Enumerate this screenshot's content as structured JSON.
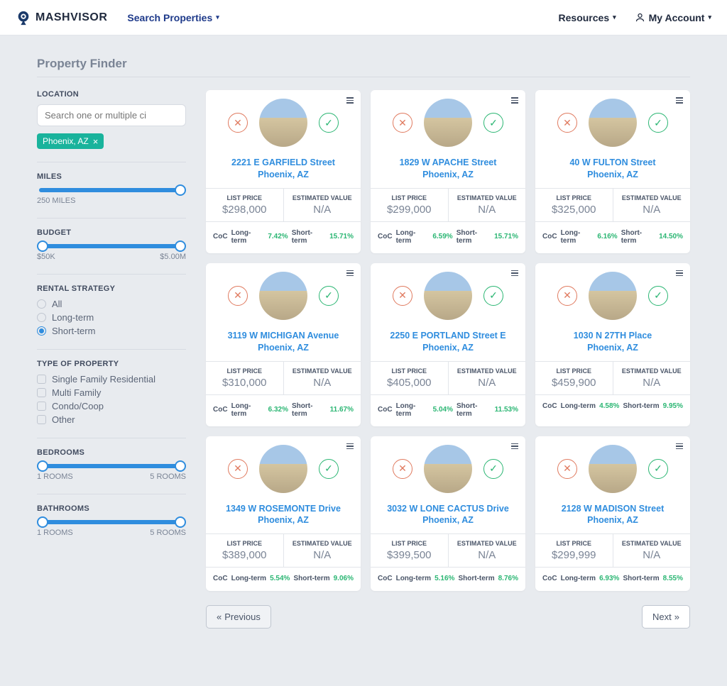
{
  "brand": "MASHVISOR",
  "nav": {
    "search": "Search Properties",
    "resources": "Resources",
    "account": "My Account"
  },
  "page_title": "Property Finder",
  "filters": {
    "location": {
      "label": "LOCATION",
      "placeholder": "Search one or multiple ci",
      "chip": "Phoenix, AZ"
    },
    "miles": {
      "label": "MILES",
      "value": "250 MILES"
    },
    "budget": {
      "label": "BUDGET",
      "min": "$50K",
      "max": "$5.00M"
    },
    "strategy": {
      "label": "RENTAL STRATEGY",
      "options": [
        "All",
        "Long-term",
        "Short-term"
      ],
      "selected": "Short-term"
    },
    "ptype": {
      "label": "TYPE OF PROPERTY",
      "options": [
        "Single Family Residential",
        "Multi Family",
        "Condo/Coop",
        "Other"
      ]
    },
    "bedrooms": {
      "label": "BEDROOMS",
      "min": "1 ROOMS",
      "max": "5 ROOMS"
    },
    "bathrooms": {
      "label": "BATHROOMS",
      "min": "1 ROOMS",
      "max": "5 ROOMS"
    }
  },
  "labels": {
    "list_price": "LIST PRICE",
    "est_value": "ESTIMATED VALUE",
    "coc": "CoC",
    "lt": "Long-term",
    "st": "Short-term"
  },
  "pager": {
    "prev": "Previous",
    "next": "Next"
  },
  "cards": [
    {
      "addr1": "2221 E GARFIELD Street",
      "addr2": "Phoenix, AZ",
      "price": "$298,000",
      "est": "N/A",
      "lt": "7.42%",
      "st": "15.71%"
    },
    {
      "addr1": "1829 W APACHE Street",
      "addr2": "Phoenix, AZ",
      "price": "$299,000",
      "est": "N/A",
      "lt": "6.59%",
      "st": "15.71%"
    },
    {
      "addr1": "40 W FULTON Street",
      "addr2": "Phoenix, AZ",
      "price": "$325,000",
      "est": "N/A",
      "lt": "6.16%",
      "st": "14.50%"
    },
    {
      "addr1": "3119 W MICHIGAN Avenue",
      "addr2": "Phoenix, AZ",
      "price": "$310,000",
      "est": "N/A",
      "lt": "6.32%",
      "st": "11.67%"
    },
    {
      "addr1": "2250 E PORTLAND Street E",
      "addr2": "Phoenix, AZ",
      "price": "$405,000",
      "est": "N/A",
      "lt": "5.04%",
      "st": "11.53%"
    },
    {
      "addr1": "1030 N 27TH Place",
      "addr2": "Phoenix, AZ",
      "price": "$459,900",
      "est": "N/A",
      "lt": "4.58%",
      "st": "9.95%"
    },
    {
      "addr1": "1349 W ROSEMONTE Drive",
      "addr2": "Phoenix, AZ",
      "price": "$389,000",
      "est": "N/A",
      "lt": "5.54%",
      "st": "9.06%"
    },
    {
      "addr1": "3032 W LONE CACTUS Drive",
      "addr2": "Phoenix, AZ",
      "price": "$399,500",
      "est": "N/A",
      "lt": "5.16%",
      "st": "8.76%"
    },
    {
      "addr1": "2128 W MADISON Street",
      "addr2": "Phoenix, AZ",
      "price": "$299,999",
      "est": "N/A",
      "lt": "6.93%",
      "st": "8.55%"
    }
  ]
}
